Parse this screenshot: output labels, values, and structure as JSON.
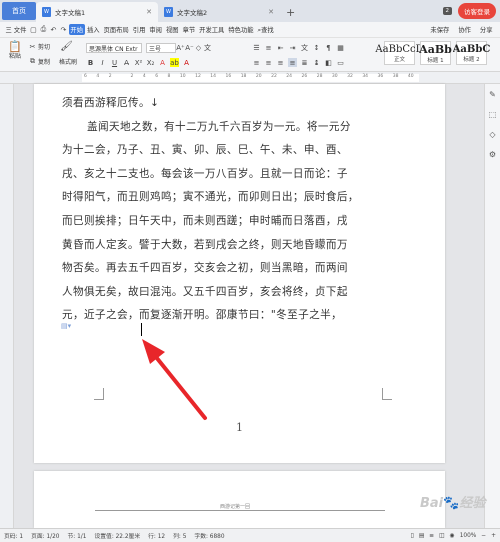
{
  "tabs": {
    "home": "首页",
    "doc1": "文字文稿1",
    "doc2": "文字文稿2",
    "badge": "2",
    "login": "访客登录"
  },
  "menu": {
    "items": [
      "三 文件",
      "开始",
      "插入",
      "页面布局",
      "引用",
      "审阅",
      "视图",
      "章节",
      "开发工具",
      "特色功能",
      "查找"
    ],
    "active_index": 1,
    "right": [
      "未保存",
      "协作",
      "分享"
    ]
  },
  "toolbar": {
    "cut": "剪切",
    "paste": "粘贴",
    "copy": "复制",
    "format_painter": "格式刷",
    "font_name": "思源黑体 CN Extr",
    "font_size": "三号",
    "styles": [
      {
        "sample": "AaBbCcD",
        "name": "正文"
      },
      {
        "sample": "AaBb",
        "name": "标题 1"
      },
      {
        "sample": "AaBbC",
        "name": "标题 2"
      }
    ]
  },
  "ruler": [
    "6",
    "4",
    "2",
    "",
    "2",
    "4",
    "6",
    "8",
    "10",
    "12",
    "14",
    "16",
    "18",
    "20",
    "22",
    "24",
    "26",
    "28",
    "30",
    "32",
    "34",
    "36",
    "38",
    "40"
  ],
  "document": {
    "lines": [
      "须看西游释厄传。↓",
      "盖闻天地之数，有十二万九千六百岁为一元。将一元分",
      "为十二会，乃子、丑、寅、卯、辰、巳、午、未、申、酉、",
      "戌、亥之十二支也。每会该一万八百岁。且就一日而论：子",
      "时得阳气，而丑则鸡鸣；寅不通光，而卯则日出；辰时食后，",
      "而巳则挨排；日午天中，而未则西蹉；申时晡而日落酉，戌",
      "黄昏而人定亥。譬于大数，若到戌会之终，则天地昏矇而万",
      "物否矣。再去五千四百岁，交亥会之初，则当黑暗，而两间",
      "人物俱无矣，故曰混沌。又五千四百岁，亥会将终，贞下起",
      "元，近子之会，而复逐渐开明。邵康节曰：\"冬至子之半，"
    ],
    "page_number": "1",
    "page2_header": "西游记第一回"
  },
  "status": {
    "page": "页码: 1",
    "pages": "页面: 1/20",
    "section": "节: 1/1",
    "position": "设置值: 22.2厘米",
    "row": "行: 12",
    "col": "列: 5",
    "words": "字数: 6880",
    "zoom": "100%"
  },
  "watermark": "Baidu经验"
}
